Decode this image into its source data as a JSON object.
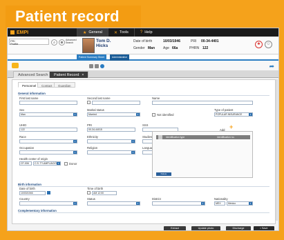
{
  "banner": {
    "title": "Patient record"
  },
  "menubar": {
    "logo": "EMPI",
    "items": [
      {
        "icon": "star-icon",
        "label": "General"
      },
      {
        "icon": "tools-icon",
        "label": "Tools"
      },
      {
        "icon": "help-icon",
        "label": "Help"
      }
    ]
  },
  "patient_bar": {
    "search_value": "PRI\nProfile",
    "advanced_search": "Advanced\nSearch",
    "name_first": "Tom D.",
    "name_last": "Hicks",
    "dob_label": "Date of birth",
    "dob_value": "10/03/1946",
    "gender_label": "Gender",
    "gender_value": "Man",
    "age_label": "Age",
    "age_value": "66a",
    "pri_label": "PRI",
    "pri_value": "00-34-4401",
    "phrn_label": "PHRN",
    "phrn_value": "122"
  },
  "blue_tabs": [
    "Patient Summary Sheet",
    "Administrative"
  ],
  "window_tabs": [
    {
      "label": "Advanced Search"
    },
    {
      "label": "Patient Record"
    }
  ],
  "inner_tabs": [
    "Personnel",
    "Contact",
    "Guardian"
  ],
  "general": {
    "section": "General information",
    "first_last_name_label": "First last name",
    "second_last_name_label": "Second last name",
    "name_label": "Name",
    "sex_label": "Sex",
    "sex_value": "Man",
    "marital_label": "Marital status",
    "marital_value": "Married",
    "not_identified": "Not identified",
    "type_label": "Type of patient",
    "type_value": "POPULAR INSURANCE",
    "uhid_label": "UHID",
    "uhid_value": "122",
    "pri_label": "PRI",
    "pri_value": "00-34-44015",
    "sss_label": "SSS",
    "race_label": "Race",
    "ethnicity_label": "Ethnicity",
    "studies_label": "Studies",
    "occupation_label": "Occupation",
    "religion_label": "Religion",
    "language_label": "Language",
    "language_count": "(0)",
    "health_center_label": "Health center of origin",
    "health_center_code": "CF-006",
    "health_center_value": "C.S. TY-AMPLIACIÓN",
    "donor_label": "Donor",
    "add_label": "Add",
    "id_type_header": "Identification type",
    "id_no_header": "Identification no.",
    "add_button": "Delete"
  },
  "birth": {
    "section": "Birth information",
    "date_label": "Date of birth",
    "date_value": "10/03/1946",
    "time_label": "Time of birth",
    "time_value": "AM 12:00",
    "country_label": "Country",
    "state_label": "Status",
    "district_label": "District",
    "nationality_label": "Nationality",
    "nationality_code": "MEX",
    "nationality_value": "Mexico"
  },
  "complementary": {
    "section": "Complementary information"
  },
  "buttons": {
    "print": "Extract",
    "update": "Update photo",
    "discharge": "Discharge",
    "save": "Save"
  }
}
